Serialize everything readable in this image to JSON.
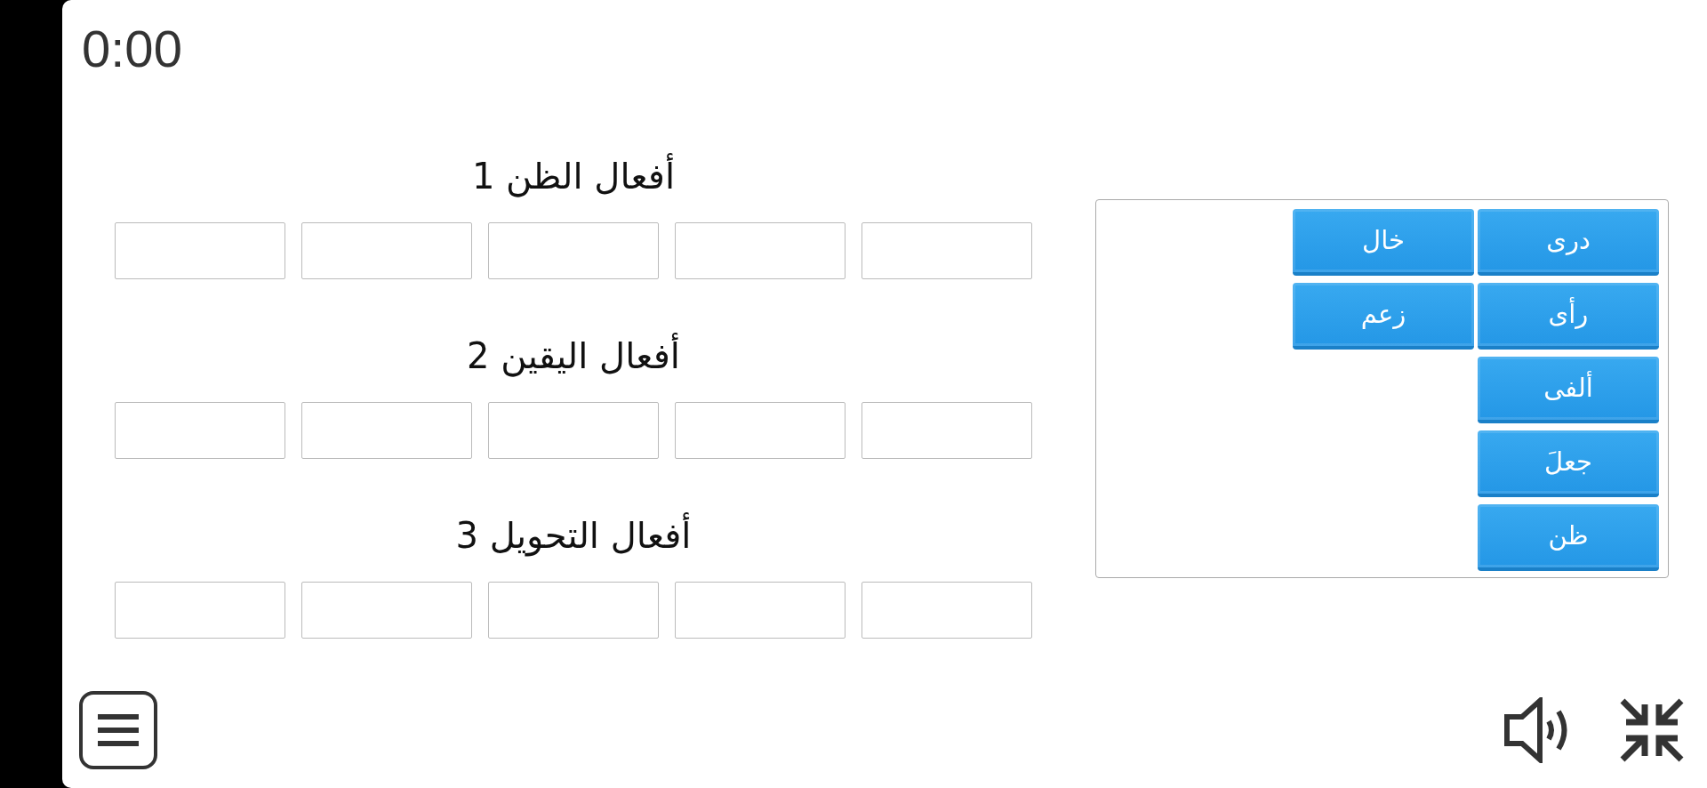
{
  "timer": "0:00",
  "groups": [
    {
      "title": "أفعال الظن 1",
      "slots": [
        {
          "filled": false
        },
        {
          "filled": false
        },
        {
          "filled": false
        },
        {
          "filled": false
        },
        {
          "filled": false
        }
      ]
    },
    {
      "title": "أفعال اليقين 2",
      "slots": [
        {
          "filled": false
        },
        {
          "filled": false
        },
        {
          "filled": false
        },
        {
          "filled": false
        },
        {
          "filled": false
        }
      ]
    },
    {
      "title": "أفعال التحويل 3",
      "slots": [
        {
          "filled": false
        },
        {
          "filled": false
        },
        {
          "filled": false
        },
        {
          "filled": false
        },
        {
          "filled": false
        }
      ]
    }
  ],
  "word_bank": {
    "columns": [
      [
        "درى",
        "رأى",
        "ألفى",
        "جعلَ",
        "ظن"
      ],
      [
        "خال",
        "زعم"
      ]
    ]
  }
}
